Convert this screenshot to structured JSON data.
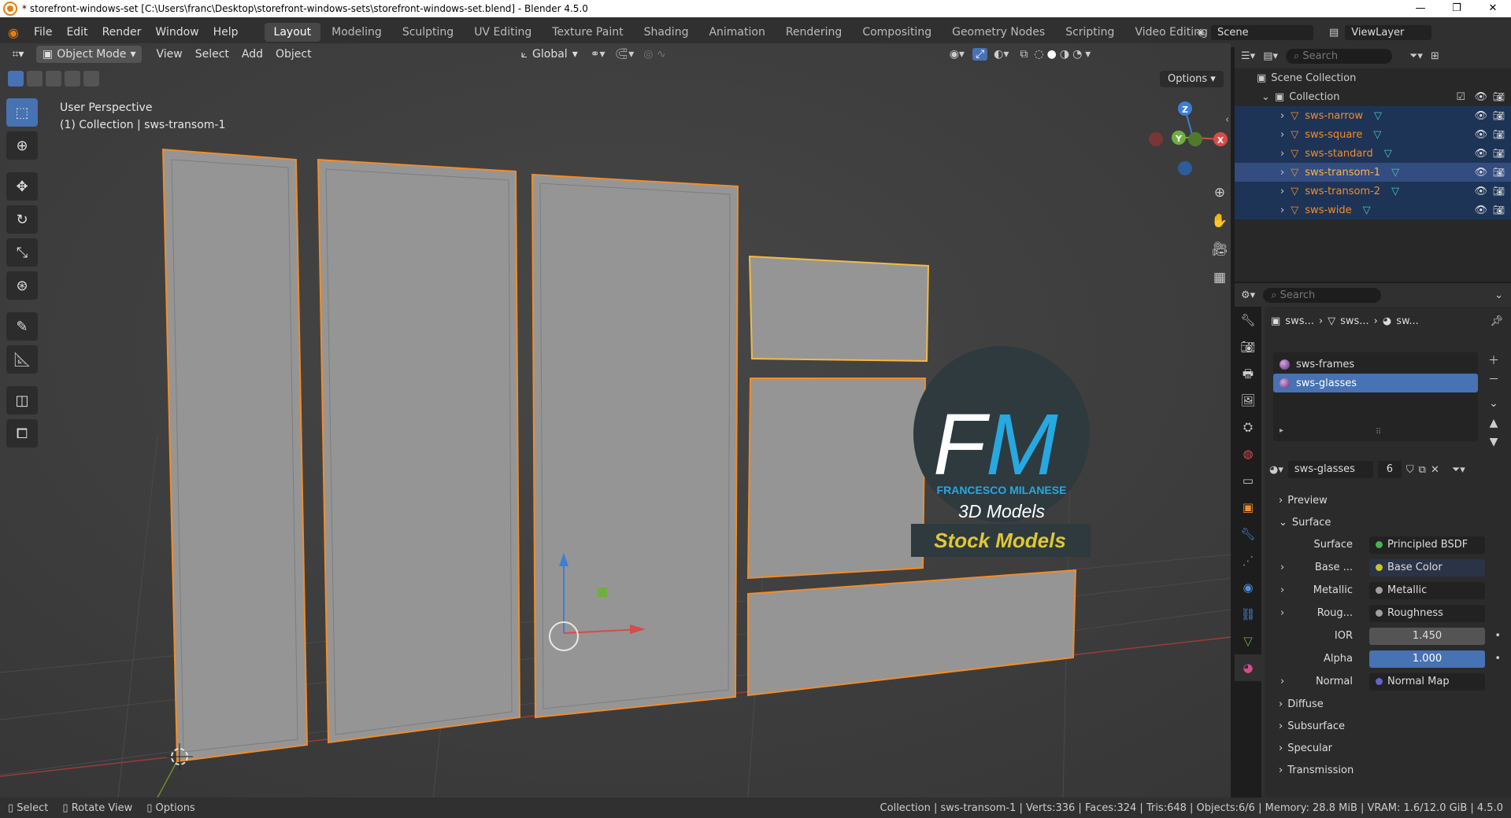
{
  "window": {
    "title": "* storefront-windows-set [C:\\Users\\franc\\Desktop\\storefront-windows-sets\\storefront-windows-set.blend] - Blender 4.5.0",
    "minimize": "—",
    "restore": "❐",
    "close": "✕"
  },
  "menu": {
    "items": [
      "File",
      "Edit",
      "Render",
      "Window",
      "Help"
    ],
    "workspaces": [
      "Layout",
      "Modeling",
      "Sculpting",
      "UV Editing",
      "Texture Paint",
      "Shading",
      "Animation",
      "Rendering",
      "Compositing",
      "Geometry Nodes",
      "Scripting",
      "Video Editing"
    ],
    "active_workspace": "Layout",
    "add_workspace": "+",
    "scene": "Scene",
    "view_layer": "ViewLayer"
  },
  "viewport_header": {
    "mode": "Object Mode",
    "menus": [
      "View",
      "Select",
      "Add",
      "Object"
    ],
    "transform_orientation": "Global",
    "options": "Options"
  },
  "viewport": {
    "perspective": "User Perspective",
    "collection_info": "(1) Collection | sws-transom-1",
    "gizmo_axes": [
      "Z",
      "Y",
      "X"
    ],
    "logo_letters_f": "F",
    "logo_letters_m": "M",
    "logo_name": "FRANCESCO MILANESE",
    "logo_sub": "3D Models",
    "stock_label": "Stock Models"
  },
  "outliner": {
    "search_placeholder": "Search",
    "scene_collection": "Scene Collection",
    "collection": "Collection",
    "objects": [
      "sws-narrow",
      "sws-square",
      "sws-standard",
      "sws-transom-1",
      "sws-transom-2",
      "sws-wide"
    ],
    "active_object": "sws-transom-1"
  },
  "properties": {
    "search_placeholder": "Search",
    "breadcrumb": [
      "sws...",
      "sws...",
      "sw..."
    ],
    "materials": [
      "sws-frames",
      "sws-glasses"
    ],
    "active_material": "sws-glasses",
    "material_name": "sws-glasses",
    "user_count": "6",
    "sections": {
      "preview": "Preview",
      "surface": "Surface",
      "diffuse": "Diffuse",
      "subsurface": "Subsurface",
      "specular": "Specular",
      "transmission": "Transmission"
    },
    "surface_rows": [
      {
        "label": "Surface",
        "value": "Principled BSDF",
        "color": "#4caf50"
      },
      {
        "label": "Base ...",
        "value": "Base Color",
        "color": "#c7c729"
      },
      {
        "label": "Metallic",
        "value": "Metallic",
        "color": "#a0a0a0"
      },
      {
        "label": "Roug...",
        "value": "Roughness",
        "color": "#a0a0a0"
      },
      {
        "label": "IOR",
        "value": "1.450",
        "color": "#a0a0a0"
      },
      {
        "label": "Alpha",
        "value": "1.000",
        "color": "#a0a0a0"
      },
      {
        "label": "Normal",
        "value": "Normal Map",
        "color": "#6363c7"
      }
    ]
  },
  "statusbar": {
    "select": "Select",
    "rotate": "Rotate View",
    "options": "Options",
    "stats": "Collection | sws-transom-1 | Verts:336 | Faces:324 | Tris:648 | Objects:6/6 | Memory: 28.8 MiB | VRAM: 1.6/12.0 GiB | 4.5.0"
  },
  "colors": {
    "accent": "#4772b3",
    "selection_outline": "#f28c28",
    "active_outline": "#f5b942"
  }
}
